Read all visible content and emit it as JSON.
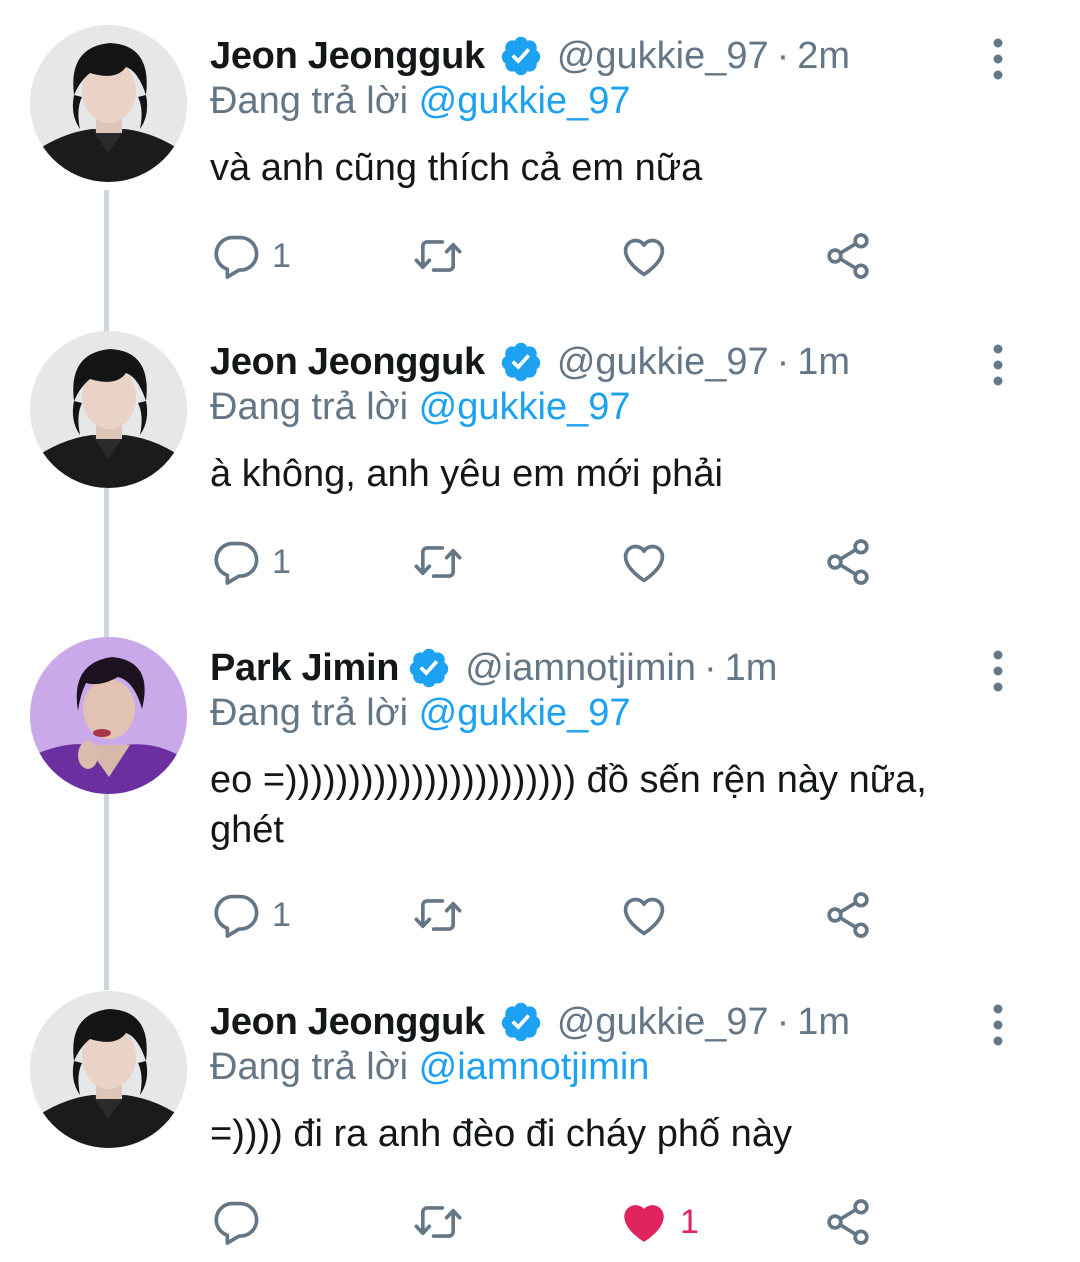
{
  "reply_prefix": "Đang trả lời",
  "colors": {
    "verified": "#1da1f2",
    "mention": "#1da1f2",
    "liked": "#e0245e",
    "secondary": "#657786",
    "thread_line": "#ccd6dd"
  },
  "tweets": [
    {
      "name": "Jeon Jeongguk",
      "handle": "@gukkie_97",
      "separator": "·",
      "time": "2m",
      "reply_to": "@gukkie_97",
      "text": "và anh cũng thích cả em nữa",
      "reply_count": "1",
      "retweet_count": "",
      "like_count": "",
      "liked": false,
      "avatar": "jeongguk-avatar"
    },
    {
      "name": "Jeon Jeongguk",
      "handle": "@gukkie_97",
      "separator": "·",
      "time": "1m",
      "reply_to": "@gukkie_97",
      "text": "à không, anh yêu em mới phải",
      "reply_count": "1",
      "retweet_count": "",
      "like_count": "",
      "liked": false,
      "avatar": "jeongguk-avatar"
    },
    {
      "name": "Park Jimin",
      "handle": "@iamnotjimin",
      "separator": "·",
      "time": "1m",
      "reply_to": "@gukkie_97",
      "text": "eo =))))))))))))))))))))))) đồ sến rện này nữa, ghét",
      "reply_count": "1",
      "retweet_count": "",
      "like_count": "",
      "liked": false,
      "avatar": "jimin-avatar"
    },
    {
      "name": "Jeon Jeongguk",
      "handle": "@gukkie_97",
      "separator": "·",
      "time": "1m",
      "reply_to": "@iamnotjimin",
      "text": "=)))) đi ra anh đèo đi cháy phố này",
      "reply_count": "",
      "retweet_count": "",
      "like_count": "1",
      "liked": true,
      "avatar": "jeongguk-avatar"
    }
  ]
}
